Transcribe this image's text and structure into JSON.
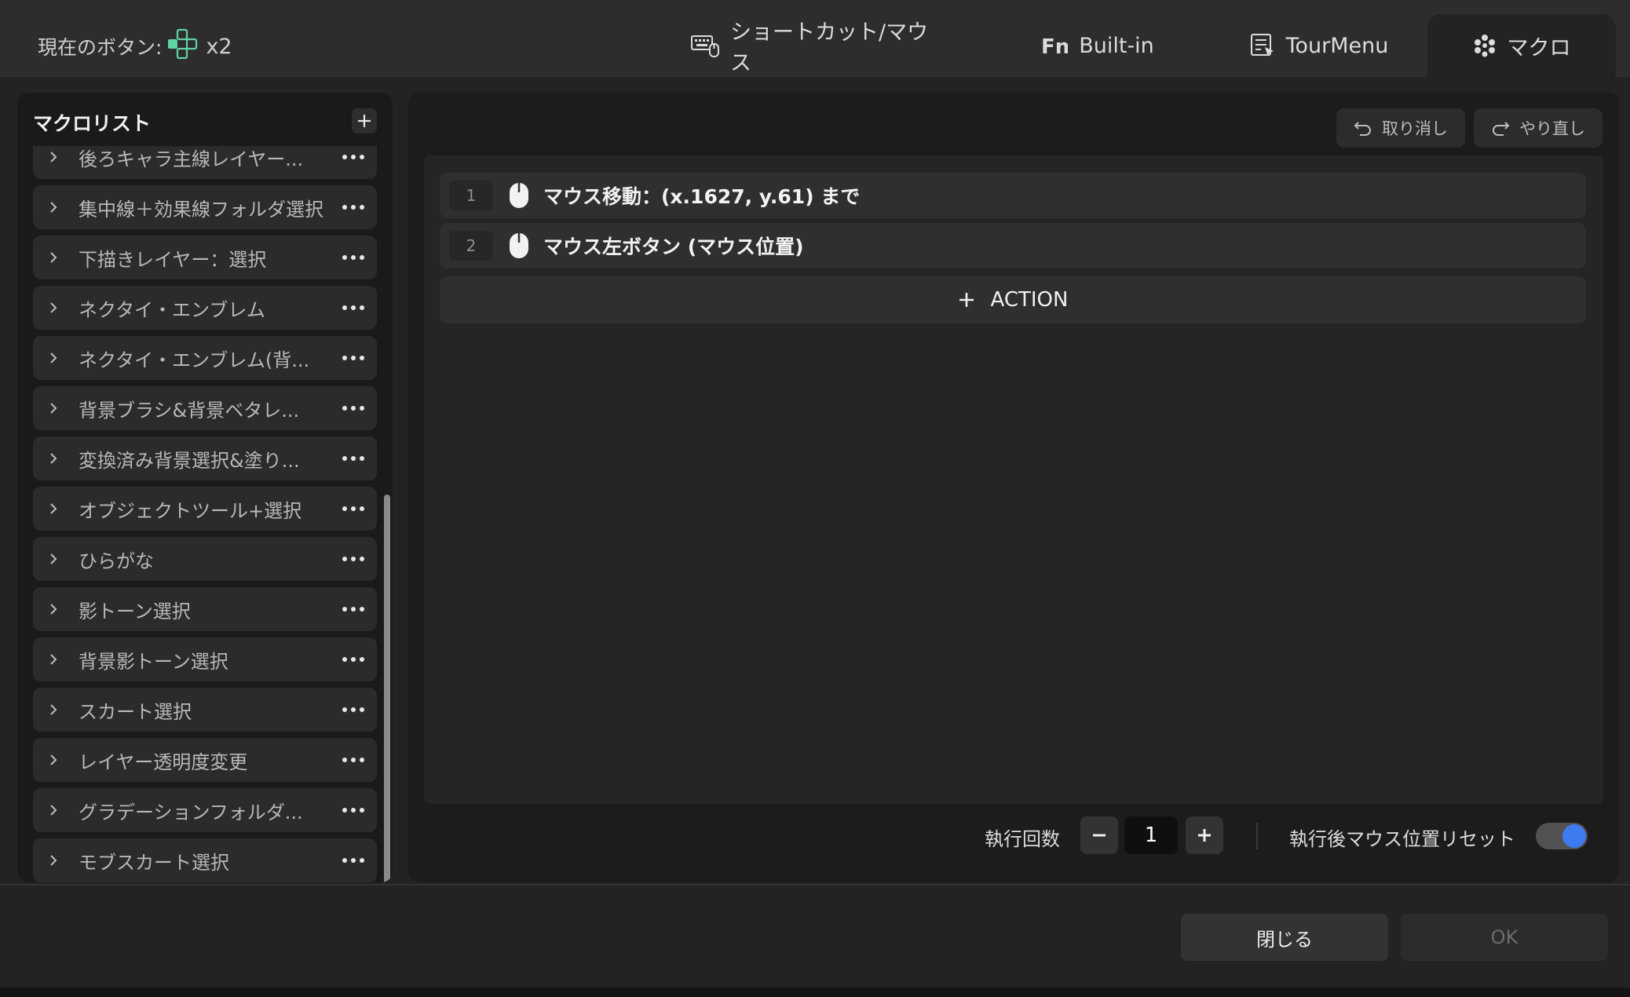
{
  "header": {
    "current_button_label": "現在のボタン:",
    "current_button_count": "x2",
    "tabs": [
      {
        "label": "ショートカット/マウス",
        "icon": "keyboard-mouse-icon"
      },
      {
        "label": "Built-in",
        "icon": "fn-icon"
      },
      {
        "label": "TourMenu",
        "icon": "tour-menu-icon"
      },
      {
        "label": "マクロ",
        "icon": "macro-icon"
      }
    ]
  },
  "macro_list": {
    "title": "マクロリスト",
    "items": [
      "後ろキャラ主線レイヤー...",
      "集中線＋効果線フォルダ選択",
      "下描きレイヤー：選択",
      "ネクタイ・エンブレム",
      "ネクタイ・エンブレム(背...",
      "背景ブラシ&背景ベタレ...",
      "変換済み背景選択&塗り...",
      "オブジェクトツール+選択",
      "ひらがな",
      "影トーン選択",
      "背景影トーン選択",
      "スカート選択",
      "レイヤー透明度変更",
      "グラデーションフォルダ...",
      "モブスカート選択"
    ]
  },
  "editor": {
    "undo_label": "取り消し",
    "redo_label": "やり直し",
    "actions": [
      {
        "num": "1",
        "text": "マウス移動：(x.1627, y.61) まで"
      },
      {
        "num": "2",
        "text": "マウス左ボタン (マウス位置)"
      }
    ],
    "add_action_label": "ACTION",
    "exec_count_label": "執行回数",
    "exec_count_value": "1",
    "reset_label": "執行後マウス位置リセット",
    "reset_enabled": true
  },
  "footer": {
    "close_label": "閉じる",
    "ok_label": "OK"
  },
  "colors": {
    "accent": "#3e7bf0",
    "controller_icon": "#5fd3a4"
  }
}
